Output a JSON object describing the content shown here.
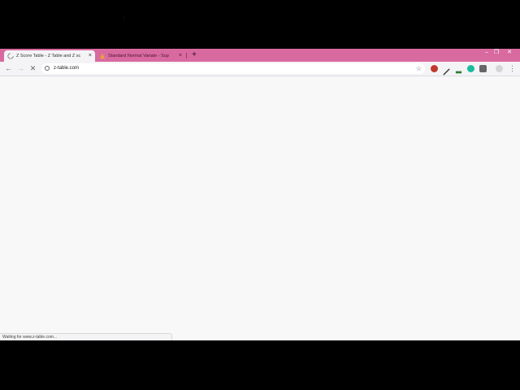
{
  "browser": {
    "tabs": [
      {
        "title": "Z Score Table - Z Table and Z sc",
        "active": true,
        "favicon": "loading-spinner-icon"
      },
      {
        "title": "Standard Normal Variate - Sup",
        "active": false,
        "favicon": "warning-icon"
      }
    ],
    "new_tab_label": "+",
    "close_glyph": "×",
    "window_controls": {
      "minimize": "–",
      "restore": "❐",
      "close": "✕"
    },
    "toolbar": {
      "back_glyph": "←",
      "forward_glyph": "→",
      "stop_glyph": "✕",
      "star_glyph": "☆",
      "menu_glyph": "⋮"
    },
    "omnibox": {
      "url": "z-table.com"
    },
    "status_text": "Waiting for www.z-table.com..."
  },
  "colors": {
    "tabstrip": "#d86aa0",
    "toolbar": "#f4f4f6",
    "page_background": "#f8f8f8"
  }
}
